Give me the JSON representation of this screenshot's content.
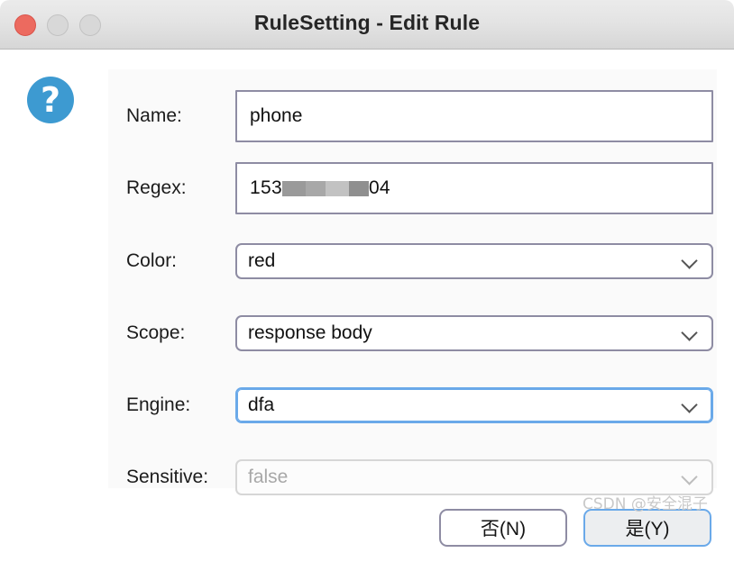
{
  "window": {
    "title": "RuleSetting - Edit Rule",
    "traffic_lights": [
      {
        "name": "close",
        "state": "active",
        "color": "#ec6a5f"
      },
      {
        "name": "minimize",
        "state": "inactive",
        "color": "#d8d8d8"
      },
      {
        "name": "zoom",
        "state": "inactive",
        "color": "#d8d8d8"
      }
    ]
  },
  "help": {
    "icon": "question-mark-icon",
    "glyph": "?",
    "color": "#3d9ad1"
  },
  "form": {
    "fields": [
      {
        "label": "Name:",
        "type": "text",
        "value": "phone",
        "placeholder": "",
        "state": "enabled"
      },
      {
        "label": "Regex:",
        "type": "text-redacted",
        "value_prefix": "153",
        "value_suffix": "04",
        "redacted": true,
        "state": "enabled"
      },
      {
        "label": "Color:",
        "type": "select",
        "value": "red",
        "state": "enabled"
      },
      {
        "label": "Scope:",
        "type": "select",
        "value": "response body",
        "state": "enabled"
      },
      {
        "label": "Engine:",
        "type": "select",
        "value": "dfa",
        "state": "focused"
      },
      {
        "label": "Sensitive:",
        "type": "select",
        "value": "false",
        "state": "disabled"
      }
    ]
  },
  "footer": {
    "no_label": "否(N)",
    "yes_label": "是(Y)",
    "default_button": "yes"
  },
  "watermark": {
    "text": "CSDN @安全混子"
  },
  "colors": {
    "accent_focus": "#6aa9e9",
    "border": "#8e8ca3",
    "help_blue": "#3d9ad1",
    "close_red": "#ec6a5f",
    "panel_bg": "#fafafa"
  }
}
